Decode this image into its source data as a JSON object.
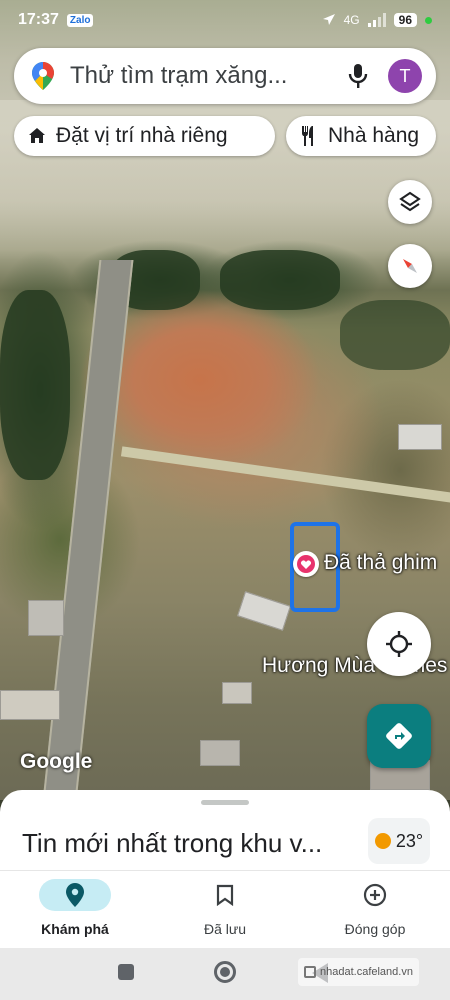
{
  "status_bar": {
    "time": "17:37",
    "app_badge": "Zalo",
    "network": "4G",
    "battery": "96"
  },
  "search": {
    "placeholder": "Thử tìm trạm xăng...",
    "avatar_letter": "T",
    "icons": [
      "maps-pin-icon",
      "mic-icon"
    ]
  },
  "chips": {
    "home_label": "Đặt vị trí nhà riêng",
    "restaurant_label": "Nhà hàng"
  },
  "map": {
    "saved_pin_label": "Đã thả ghim",
    "place_label": "Hương Mùa Homes",
    "attribution": "Google",
    "colors": {
      "pin_highlight": "#1e73e8",
      "saved_pin": "#e8336d",
      "directions_button": "#0b7e7f"
    }
  },
  "sheet": {
    "title": "Tin mới nhất trong khu v...",
    "temperature": "23°"
  },
  "bottom_nav": {
    "items": [
      {
        "label": "Khám phá",
        "icon": "explore-pin-icon",
        "active": true
      },
      {
        "label": "Đã lưu",
        "icon": "bookmark-icon",
        "active": false
      },
      {
        "label": "Đóng góp",
        "icon": "add-circle-icon",
        "active": false
      }
    ]
  },
  "watermark": "nhadat.cafeland.vn"
}
